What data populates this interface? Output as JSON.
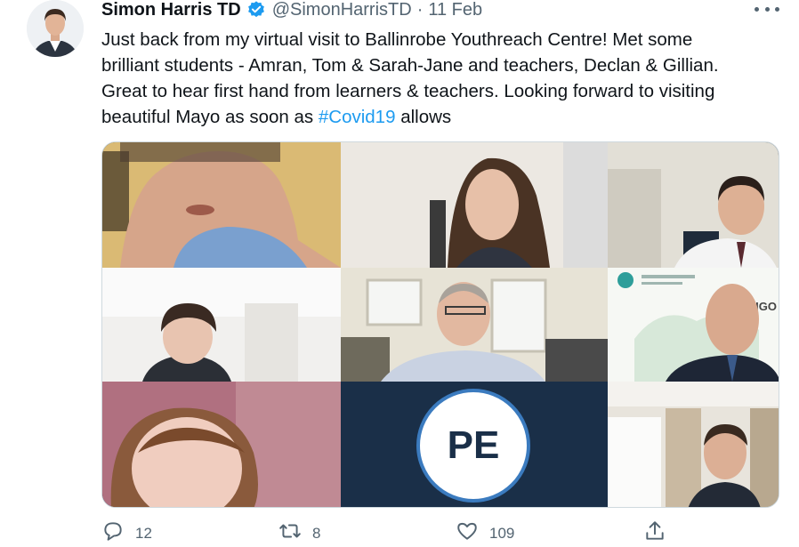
{
  "author": {
    "display_name": "Simon Harris TD",
    "handle": "@SimonHarrisTD",
    "separator": "·",
    "date": "11 Feb",
    "verified": true
  },
  "tweet": {
    "lines": [
      "Just back from my virtual visit to Ballinrobe Youthreach Centre! Met some",
      "brilliant students - Amran, Tom & Sarah-Jane and teachers, Declan & Gillian.",
      "Great to hear first hand from learners & teachers. Looking forward to visiting"
    ],
    "last_line_before": "beautiful Mayo as soon as ",
    "hashtag": "#Covid19",
    "last_line_after": " allows"
  },
  "media": {
    "participant_initials": "PE",
    "sign_text": "IGO"
  },
  "actions": {
    "reply_count": "12",
    "retweet_count": "8",
    "like_count": "109"
  },
  "icons": [
    "verified-badge-icon",
    "more-icon",
    "reply-icon",
    "retweet-icon",
    "like-icon",
    "share-icon"
  ],
  "colors": {
    "accent": "#1d9bf0",
    "secondary_text": "#536471",
    "verified": "#1d9bf0"
  }
}
